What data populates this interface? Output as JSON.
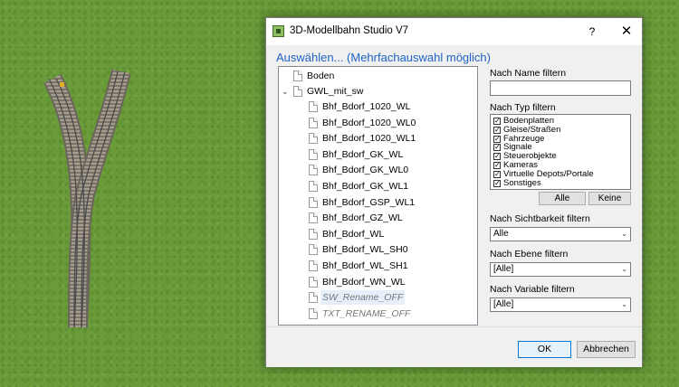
{
  "window": {
    "title": "3D-Modellbahn Studio V7",
    "help_glyph": "?",
    "close_glyph": "✕"
  },
  "header": "Auswählen... (Mehrfachauswahl möglich)",
  "tree": {
    "root_item": "Boden",
    "group": {
      "label": "GWL_mit_sw",
      "expander": "⌄"
    },
    "children": [
      "Bhf_Bdorf_1020_WL",
      "Bhf_Bdorf_1020_WL0",
      "Bhf_Bdorf_1020_WL1",
      "Bhf_Bdorf_GK_WL",
      "Bhf_Bdorf_GK_WL0",
      "Bhf_Bdorf_GK_WL1",
      "Bhf_Bdorf_GSP_WL1",
      "Bhf_Bdorf_GZ_WL",
      "Bhf_Bdorf_WL",
      "Bhf_Bdorf_WL_SH0",
      "Bhf_Bdorf_WL_SH1",
      "Bhf_Bdorf_WN_WL"
    ],
    "italic_children": [
      "SW_Rename_OFF",
      "TXT_RENAME_OFF"
    ]
  },
  "filters": {
    "name_label": "Nach Name filtern",
    "name_value": "",
    "type_label": "Nach Typ filtern",
    "types": [
      "Bodenplatten",
      "Gleise/Straßen",
      "Fahrzeuge",
      "Signale",
      "Steuerobjekte",
      "Kameras",
      "Virtuelle Depots/Portale",
      "Sonstiges"
    ],
    "check_glyph": "✓",
    "all_button": "Alle",
    "none_button": "Keine",
    "visibility_label": "Nach Sichtbarkeit filtern",
    "visibility_value": "Alle",
    "layer_label": "Nach Ebene filtern",
    "layer_value": "[Alle]",
    "variable_label": "Nach Variable filtern",
    "variable_value": "[Alle]",
    "dropdown_glyph": "⌄"
  },
  "footer": {
    "ok_label": "OK",
    "cancel_label": "Abbrechen"
  },
  "colors": {
    "header_blue": "#1f63c6",
    "grass": "#6a9a3a",
    "ok_border": "#0078d7"
  }
}
